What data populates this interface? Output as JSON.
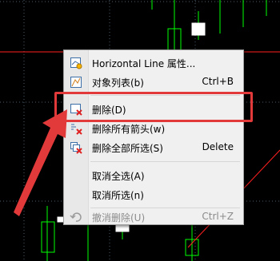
{
  "menu": {
    "items": [
      {
        "id": "properties",
        "icon": "hline-properties-icon",
        "label": "Horizontal Line 属性...",
        "shortcut": "",
        "enabled": true
      },
      {
        "id": "object-list",
        "icon": "object-list-icon",
        "label": "对象列表(b)",
        "shortcut": "Ctrl+B",
        "enabled": true
      },
      {
        "id": "delete",
        "icon": "delete-object-icon",
        "label": "删除(D)",
        "shortcut": "",
        "enabled": true
      },
      {
        "id": "delete-arrows",
        "icon": "delete-arrows-icon",
        "label": "删除所有箭头(w)",
        "shortcut": "",
        "enabled": true
      },
      {
        "id": "delete-selected",
        "icon": "delete-selected-icon",
        "label": "删除全部所选(S)",
        "shortcut": "Delete",
        "enabled": true
      },
      {
        "id": "unselect-all",
        "icon": "",
        "label": "取消全选(A)",
        "shortcut": "",
        "enabled": true
      },
      {
        "id": "unselect",
        "icon": "",
        "label": "取消所选(n)",
        "shortcut": "",
        "enabled": true
      },
      {
        "id": "undo-delete",
        "icon": "undo-icon",
        "label": "撤消删除(U)",
        "shortcut": "Ctrl+Z",
        "enabled": false
      }
    ]
  },
  "colors": {
    "background": "#000000",
    "grid": "#4a5a6a",
    "candle": "#00ff00",
    "hline": "#ff2020",
    "annotation": "#e23a3a"
  }
}
